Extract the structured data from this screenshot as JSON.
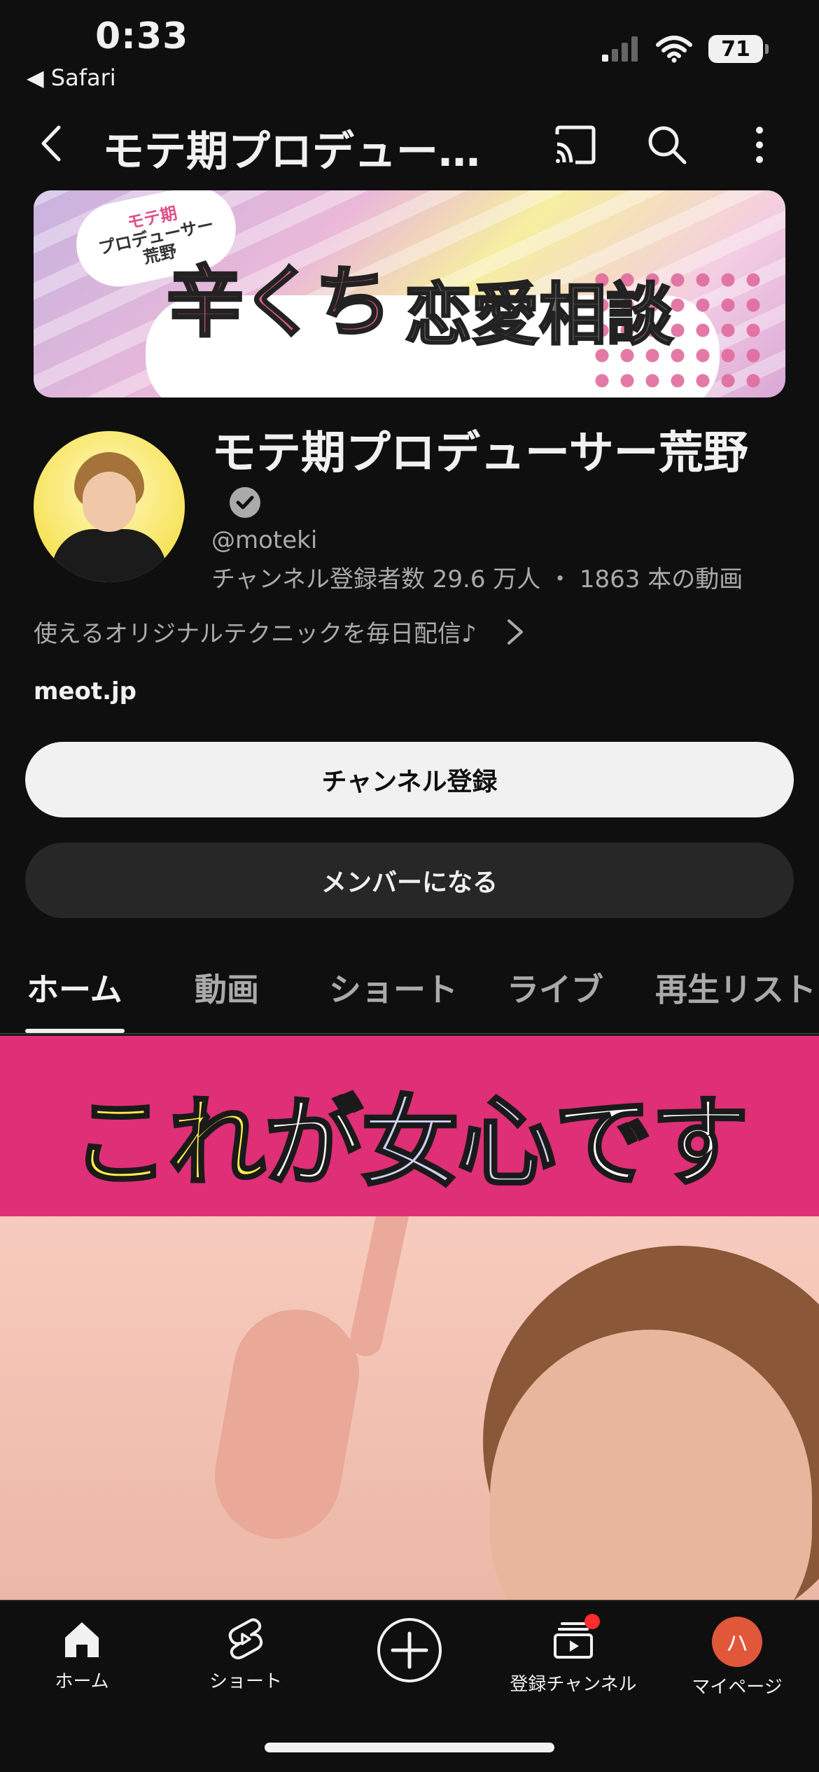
{
  "status_bar": {
    "time": "0:33",
    "back_app": "◀ Safari",
    "battery": "71"
  },
  "app_bar": {
    "title": "モテ期プロデュー…"
  },
  "banner": {
    "badge_line1": "モテ期",
    "badge_line2": "プロデューサー",
    "badge_line3": "荒野",
    "main_text": "辛くち",
    "sub_text": "恋愛相談"
  },
  "channel": {
    "name": "モテ期プロデューサー荒野",
    "handle": "@moteki",
    "stats": "チャンネル登録者数 29.6 万人 ・ 1863 本の動画",
    "description": "使えるオリジナルテクニックを毎日配信♪",
    "link": "meot.jp"
  },
  "buttons": {
    "subscribe": "チャンネル登録",
    "member": "メンバーになる"
  },
  "tabs": [
    {
      "label": "ホーム",
      "active": true
    },
    {
      "label": "動画",
      "active": false
    },
    {
      "label": "ショート",
      "active": false
    },
    {
      "label": "ライブ",
      "active": false
    },
    {
      "label": "再生リスト",
      "active": false
    }
  ],
  "video": {
    "caption_part1": "これ",
    "caption_part2": "が",
    "caption_part3": "女心",
    "caption_part4": "です"
  },
  "bottom_nav": {
    "home": "ホーム",
    "shorts": "ショート",
    "subscriptions": "登録チャンネル",
    "my_page": "マイページ",
    "avatar_initial": "ハ"
  },
  "colors": {
    "background": "#0f0f0f",
    "subscribe_bg": "#f1f1f1",
    "member_bg": "#272727",
    "notification": "#ff2d2d",
    "my_avatar": "#e0573a"
  }
}
